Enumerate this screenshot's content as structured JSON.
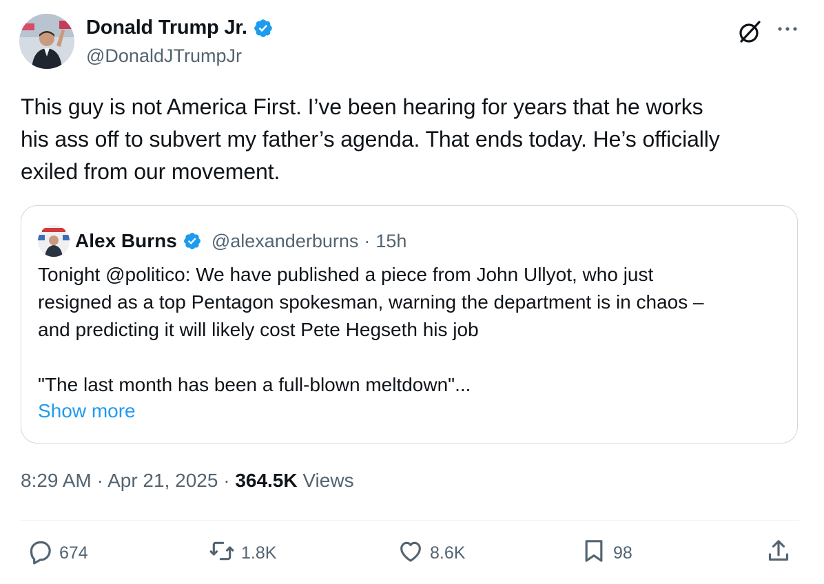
{
  "tweet": {
    "author_name": "Donald Trump Jr.",
    "author_handle": "@DonaldJTrumpJr",
    "text": "This guy is not America First. I’ve been hearing for years that he works\nhis ass off to subvert my father’s agenda. That ends today. He’s officially\nexiled from our movement.",
    "time": "8:29 AM",
    "date": "Apr 21, 2025",
    "views_count": "364.5K",
    "views_label": "Views",
    "separator": " · "
  },
  "quote": {
    "author_name": "Alex Burns",
    "author_handle": "@alexanderburns",
    "age": "15h",
    "text": "Tonight @politico: We have published a piece from John Ullyot, who just\nresigned as a top Pentagon spokesman, warning the department is in chaos –\n and predicting it will likely cost Pete Hegseth his job\n\n\"The last month has been a full-blown meltdown\"...",
    "show_more": "Show more"
  },
  "actions": {
    "replies": "674",
    "reposts": "1.8K",
    "likes": "8.6K",
    "bookmarks": "98"
  },
  "icons": [
    "verified-badge-icon",
    "grok-icon",
    "more-icon",
    "reply-icon",
    "repost-icon",
    "like-icon",
    "bookmark-icon",
    "share-icon"
  ],
  "colors": {
    "verified": "#1d9bf0",
    "link": "#1d9bf0",
    "secondary_text": "#536471",
    "border": "#cfd9de"
  }
}
